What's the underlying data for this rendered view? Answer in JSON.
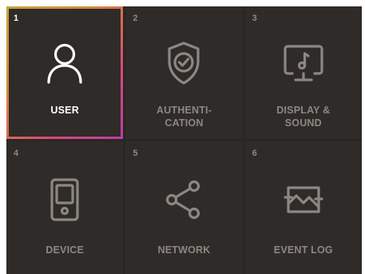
{
  "menu": {
    "tiles": [
      {
        "number": "1",
        "label": "USER",
        "icon": "user-icon",
        "selected": true
      },
      {
        "number": "2",
        "label": "AUTHENTI-\nCATION",
        "icon": "shield-check-icon",
        "selected": false
      },
      {
        "number": "3",
        "label": "DISPLAY &\nSOUND",
        "icon": "monitor-music-icon",
        "selected": false
      },
      {
        "number": "4",
        "label": "DEVICE",
        "icon": "device-icon",
        "selected": false
      },
      {
        "number": "5",
        "label": "NETWORK",
        "icon": "share-icon",
        "selected": false
      },
      {
        "number": "6",
        "label": "EVENT LOG",
        "icon": "event-log-icon",
        "selected": false
      }
    ]
  },
  "colors": {
    "background": "#2f2b29",
    "grid_gap": "#2a2624",
    "text_inactive": "#8c8782",
    "text_active": "#ffffff",
    "selection_gradient": [
      "#c8a33a",
      "#d7863a",
      "#d94a78",
      "#c33aa6"
    ]
  }
}
